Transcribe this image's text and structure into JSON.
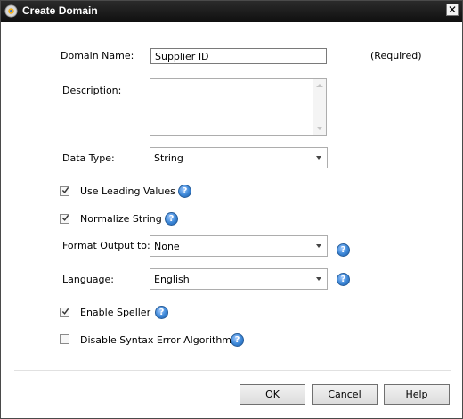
{
  "window": {
    "title": "Create Domain",
    "close_glyph": "✕"
  },
  "form": {
    "domain_name": {
      "label": "Domain Name:",
      "value": "Supplier ID",
      "note": "(Required)"
    },
    "description": {
      "label": "Description:",
      "value": ""
    },
    "data_type": {
      "label": "Data Type:",
      "value": "String"
    },
    "use_leading_values": {
      "label": "Use Leading Values",
      "checked": true
    },
    "normalize_string": {
      "label": "Normalize String",
      "checked": true
    },
    "format_output": {
      "label": "Format Output to:",
      "value": "None"
    },
    "language": {
      "label": "Language:",
      "value": "English"
    },
    "enable_speller": {
      "label": "Enable Speller",
      "checked": true
    },
    "disable_syntax": {
      "label": "Disable Syntax Error Algorithms",
      "checked": false
    }
  },
  "help_glyph": "?",
  "buttons": {
    "ok": "OK",
    "cancel": "Cancel",
    "help": "Help"
  },
  "colors": {
    "help_icon": "#3b86d6",
    "title_bar": "#1a1a1a"
  }
}
